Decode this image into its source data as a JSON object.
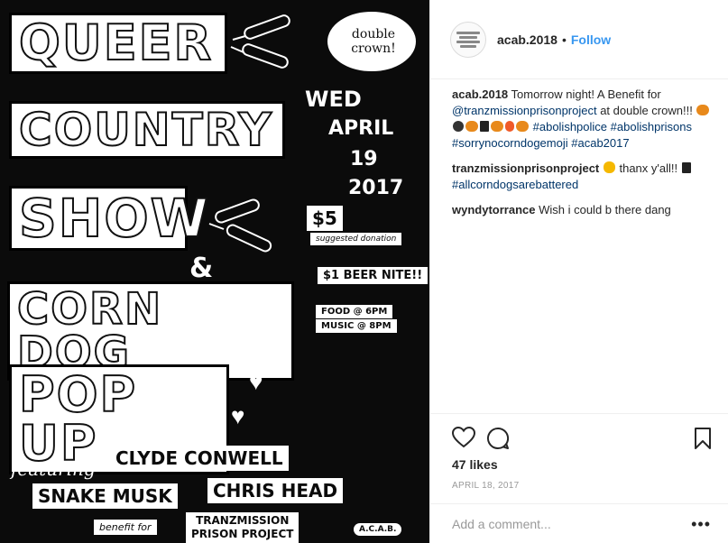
{
  "poster": {
    "line1": "QUEER",
    "line2": "COUNTRY",
    "line3": "SHOW",
    "amp": "&",
    "line4": "CORN DOG",
    "line5": "POP UP",
    "badge": "double crown!",
    "date_day": "WED",
    "date_month": "APRIL",
    "date_num": "19",
    "date_year": "2017",
    "price": "$5",
    "price_note": "suggested donation",
    "beer": "$1 BEER NITE!!",
    "food": "FOOD @ 6PM",
    "music": "MUSIC @ 8PM",
    "featuring": "featuring",
    "artist1": "CLYDE CONWELL",
    "artist2": "SNAKE MUSK",
    "artist3": "CHRIS HEAD",
    "benefit_for": "benefit for",
    "benefit_org_1": "TRANZMISSION",
    "benefit_org_2": "PRISON PROJECT",
    "logo_text": "A.C.A.B."
  },
  "header": {
    "username": "acab.2018",
    "separator": "•",
    "follow_label": "Follow"
  },
  "comments": [
    {
      "user": "acab.2018",
      "text_before_link": " Tomorrow night! A Benefit for ",
      "mention": "@tranzmissionprisonproject",
      "text_after_mention": " at double crown!!! ",
      "tags": [
        "#abolishpolice",
        "#abolishprisons",
        "#sorrynocorndogemoji",
        "#acab2017"
      ]
    },
    {
      "user": "tranzmissionprisonproject",
      "text": " thanx y'all!! ",
      "tag": "#allcorndogsarebattered"
    },
    {
      "user": "wyndytorrance",
      "text": " Wish i could b there dang"
    }
  ],
  "actions": {
    "likes": "47 likes",
    "date": "APRIL 18, 2017",
    "icons": [
      "heart-icon",
      "comment-icon",
      "bookmark-icon"
    ]
  },
  "add_comment": {
    "placeholder": "Add a comment...",
    "more": "•••"
  },
  "colors": {
    "link": "#003569",
    "follow": "#3897f0",
    "poster_bg": "#0b0b0b"
  }
}
